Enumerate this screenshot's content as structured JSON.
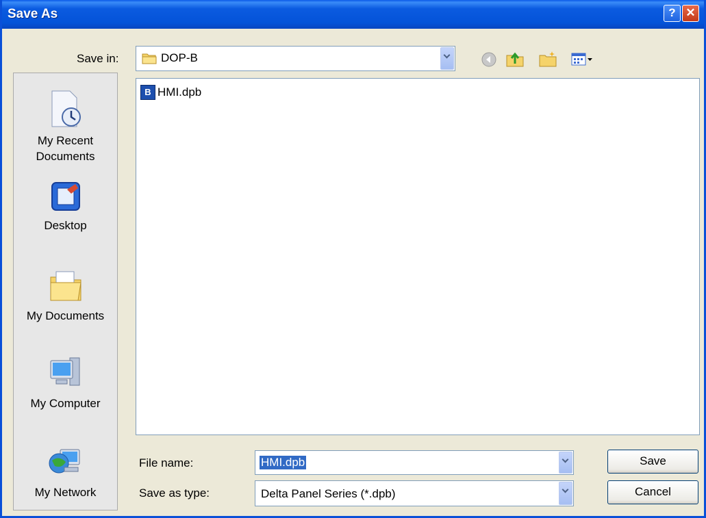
{
  "window": {
    "title": "Save As",
    "help_glyph": "?",
    "close_glyph": "✕"
  },
  "toolbar": {
    "save_in_label": "Save in:",
    "save_in_value": "DOP-B",
    "icons": [
      "back-icon",
      "up-folder-icon",
      "new-folder-icon",
      "views-menu-icon"
    ]
  },
  "places": [
    {
      "id": "recent",
      "icon": "recent-documents-icon",
      "label_lines": [
        "My Recent",
        "Documents"
      ]
    },
    {
      "id": "desktop",
      "icon": "desktop-icon",
      "label_lines": [
        "Desktop"
      ]
    },
    {
      "id": "documents",
      "icon": "my-documents-icon",
      "label_lines": [
        "My Documents"
      ]
    },
    {
      "id": "computer",
      "icon": "my-computer-icon",
      "label_lines": [
        "My Computer"
      ]
    },
    {
      "id": "network",
      "icon": "my-network-icon",
      "label_lines": [
        "My Network"
      ]
    }
  ],
  "files": [
    {
      "name": "HMI.dpb",
      "icon": "dpb-file-icon",
      "icon_badge": "B"
    }
  ],
  "form": {
    "file_name_label": "File name:",
    "file_name_value": "HMI.dpb",
    "type_label": "Save as type:",
    "type_value": "Delta Panel Series (*.dpb)"
  },
  "buttons": {
    "save": "Save",
    "cancel": "Cancel"
  },
  "colors": {
    "titlebar": "#0453d8",
    "selection": "#316ac5",
    "dialog_bg": "#ece9d8"
  }
}
